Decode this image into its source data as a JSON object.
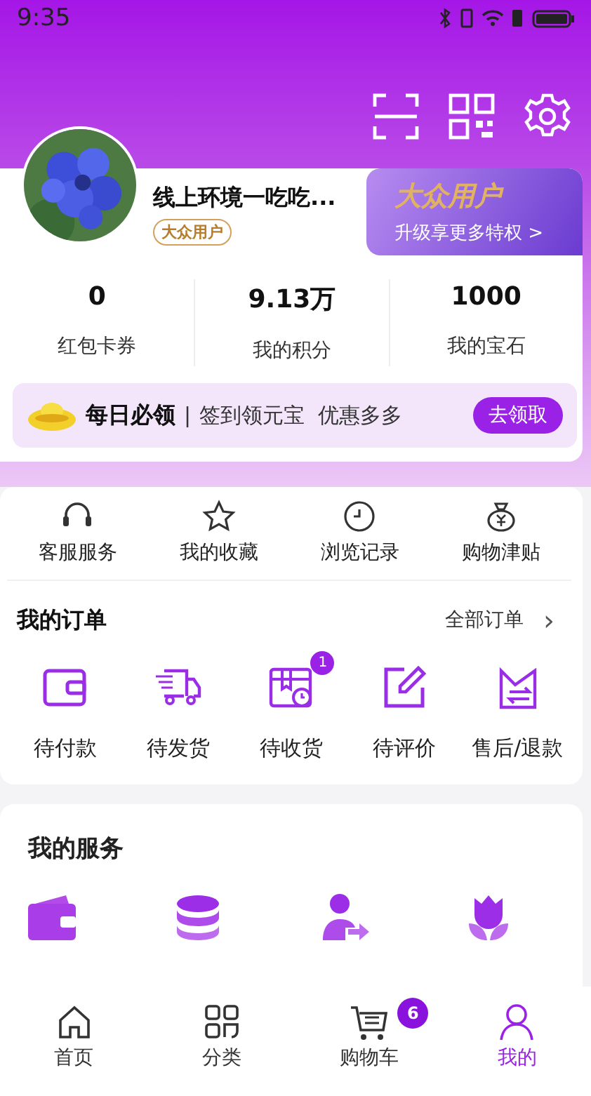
{
  "status_bar": {
    "time": "9:35"
  },
  "profile": {
    "name": "线上环境一吃吃...",
    "badge": "大众用户",
    "member_title": "大众用户",
    "member_link": "升级享更多特权 >"
  },
  "stats": [
    {
      "value": "0",
      "label": "红包卡券"
    },
    {
      "value": "9.13万",
      "label": "我的积分"
    },
    {
      "value": "1000",
      "label": "我的宝石"
    }
  ],
  "sign_banner": {
    "title": "每日必领",
    "separator": "|",
    "text": "签到领元宝  优惠多多",
    "button": "去领取"
  },
  "quick_links": [
    {
      "kind": "headset",
      "label": "客服服务"
    },
    {
      "kind": "star",
      "label": "我的收藏"
    },
    {
      "kind": "clock",
      "label": "浏览记录"
    },
    {
      "kind": "moneybag",
      "label": "购物津贴"
    }
  ],
  "orders": {
    "title": "我的订单",
    "all_link": "全部订单",
    "chevron": "›",
    "items": [
      {
        "kind": "wallet",
        "label": "待付款"
      },
      {
        "kind": "truck",
        "label": "待发货"
      },
      {
        "kind": "box",
        "label": "待收货",
        "badge": "1"
      },
      {
        "kind": "edit",
        "label": "待评价"
      },
      {
        "kind": "refund",
        "label": "售后/退款"
      }
    ]
  },
  "services": {
    "title": "我的服务",
    "items": [
      {
        "kind": "wallet"
      },
      {
        "kind": "coins"
      },
      {
        "kind": "person"
      },
      {
        "kind": "flower"
      }
    ]
  },
  "tab_bar": [
    {
      "kind": "home",
      "label": "首页",
      "selected": false
    },
    {
      "kind": "grid",
      "label": "分类",
      "selected": false
    },
    {
      "kind": "cart",
      "label": "购物车",
      "selected": false,
      "badge": "6"
    },
    {
      "kind": "user",
      "label": "我的",
      "selected": true
    }
  ]
}
